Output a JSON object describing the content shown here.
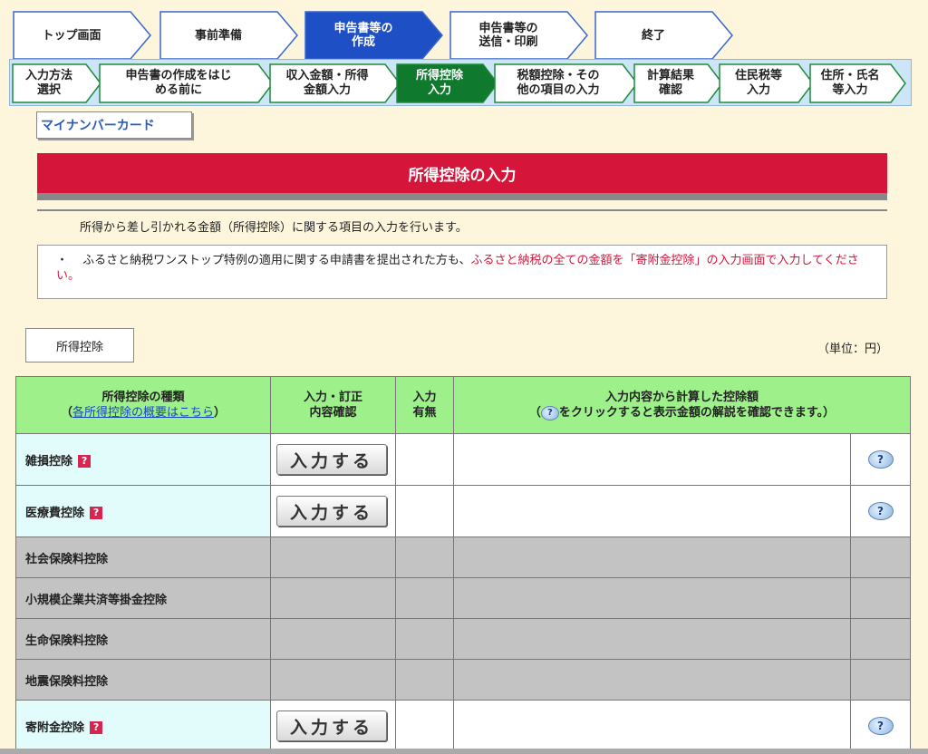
{
  "main_steps": [
    {
      "label": "トップ画面",
      "state": "done"
    },
    {
      "label": "事前準備",
      "state": "done"
    },
    {
      "label": "申告書等の\n作成",
      "state": "current"
    },
    {
      "label": "申告書等の\n送信・印刷",
      "state": "todo"
    },
    {
      "label": "終了",
      "state": "todo"
    }
  ],
  "sub_steps": [
    {
      "label": "入力方法\n選択",
      "state": "done"
    },
    {
      "label": "申告書の作成をはじ\nめる前に",
      "state": "done"
    },
    {
      "label": "収入金額・所得\n金額入力",
      "state": "done"
    },
    {
      "label": "所得控除\n入力",
      "state": "current"
    },
    {
      "label": "税額控除・その\n他の項目の入力",
      "state": "todo"
    },
    {
      "label": "計算結果\n確認",
      "state": "todo"
    },
    {
      "label": "住民税等\n入力",
      "state": "todo"
    },
    {
      "label": "住所・氏名\n等入力",
      "state": "todo"
    }
  ],
  "mynumber_button": "マイナンバーカード",
  "page_title": "所得控除の入力",
  "description": "所得から差し引かれる金額（所得控除）に関する項目の入力を行います。",
  "notice": {
    "bullet": "・",
    "text_black": "ふるさと納税ワンストップ特例の適用に関する申請書を提出された方も、",
    "text_red": "ふるさと納税の全ての金額を「寄附金控除」の入力画面で入力してください。"
  },
  "section_label": "所得控除",
  "unit_label": "（単位：円）",
  "table": {
    "header_type": "所得控除の種類",
    "header_type_link": "各所得控除の概要はこちら",
    "header_input": "入力・訂正\n内容確認",
    "header_status": "入力\n有無",
    "header_amount": "入力内容から計算した控除額",
    "header_amount_note_pre": "（",
    "header_amount_note_post": "をクリックすると表示金額の解説を確認できます。）",
    "input_button_label": "入力する",
    "help_icon_glyph": "?",
    "rows": [
      {
        "name": "雑損控除",
        "active": true
      },
      {
        "name": "医療費控除",
        "active": true
      },
      {
        "name": "社会保険料控除",
        "active": false
      },
      {
        "name": "小規模企業共済等掛金控除",
        "active": false
      },
      {
        "name": "生命保険料控除",
        "active": false
      },
      {
        "name": "地震保険料控除",
        "active": false
      },
      {
        "name": "寄附金控除",
        "active": true
      }
    ]
  },
  "colors": {
    "background": "#fdf5dc",
    "title_red": "#d5153a",
    "current_step": "#1f4fc4",
    "current_substep": "#0f7a2e",
    "header_green": "#9ef08a",
    "active_name_cell": "#e2fcfc",
    "inactive_row": "#c3c3c3"
  }
}
